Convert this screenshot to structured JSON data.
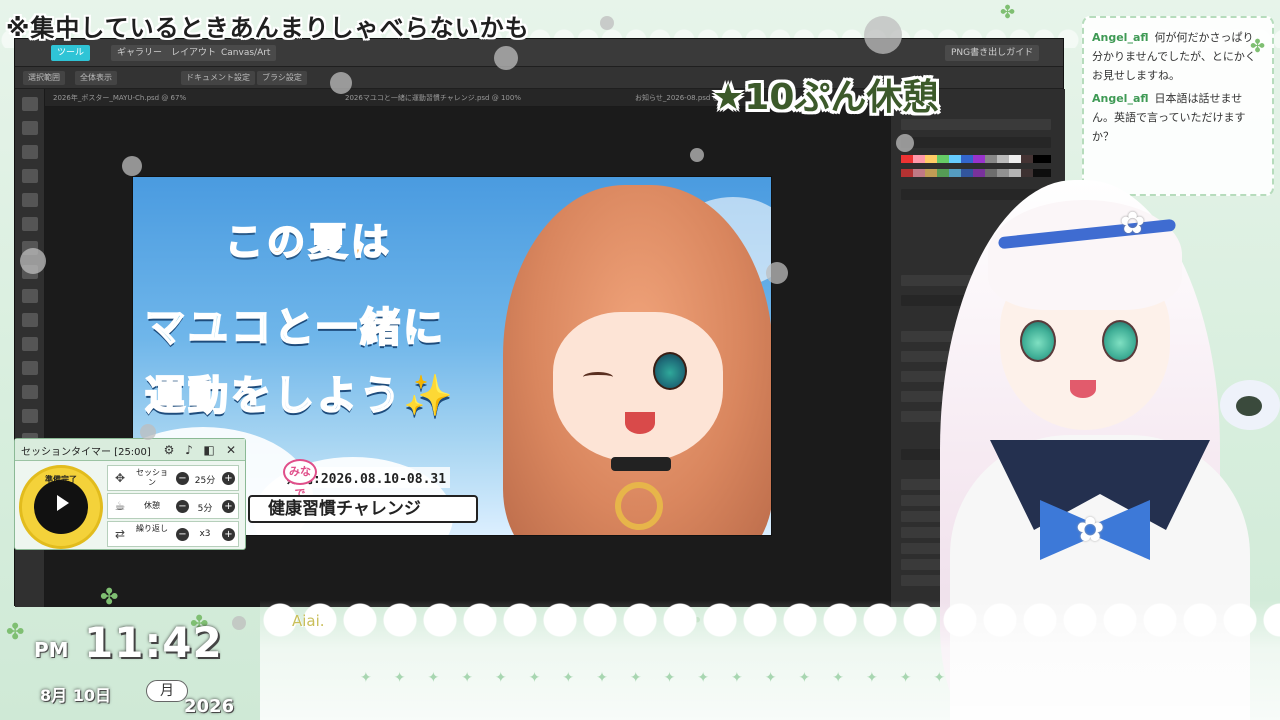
{
  "banner": {
    "text": "※集中しているときあんまりしゃべらないかも"
  },
  "break_notice": {
    "text": "★10ぷん休憩"
  },
  "app": {
    "toolbar": {
      "buttons": [
        "ツール",
        "ギャラリー",
        "レイアウト",
        "Canvas/Art",
        "PNG書き出しガイド"
      ]
    },
    "subbar": {
      "items": [
        "選択範囲",
        "全体表示",
        "ドキュメント設定",
        "ブラシ設定"
      ]
    },
    "tabs": [
      "2026年_ポスター_MAYU-Ch.psd @ 67%",
      "2026マユコと一緒に運動習慣チャレンジ.psd @ 100%",
      "お知らせ_2026-08.psd @ 50%"
    ]
  },
  "artwork": {
    "line1": "この夏は",
    "line2": "マユコと一緒に",
    "line3": "運動をしよう",
    "sparkle": "✨",
    "badge": "みなで",
    "period": "期間:2026.08.10-08.31",
    "challenge": "健康習慣チャレンジ"
  },
  "chat": {
    "messages": [
      {
        "user": "Angel_afl",
        "text": "何が何だかさっぱり分かりませんでしたが、とにかくお見せしますね。"
      },
      {
        "user": "Angel_afl",
        "text": "日本語は話せません。英語で言っていただけますか？"
      }
    ]
  },
  "timer": {
    "title": "セッションタイマー [25:00]",
    "status": "準備完了",
    "rows": [
      {
        "label": "セッション",
        "value": "25分"
      },
      {
        "label": "休憩",
        "value": "5分"
      },
      {
        "label": "繰り返し",
        "value": "x3"
      }
    ]
  },
  "clock": {
    "ampm": "PM",
    "time": "11:42",
    "date": "8月 10日",
    "day": "月",
    "year": "2026"
  },
  "caption": {
    "text": "Aiai."
  },
  "colors": {
    "accent": "#2fc4d6",
    "background": "#e7f4ea",
    "chat_user": "#3f9a55",
    "timer_circle": "#f4d23a"
  }
}
